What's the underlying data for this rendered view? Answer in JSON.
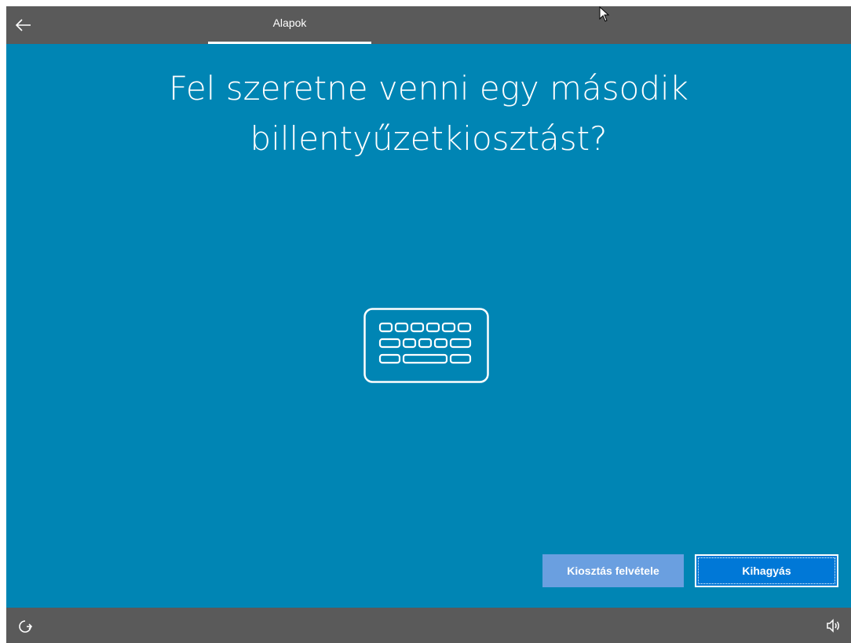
{
  "header": {
    "back_icon": "arrow-left-icon",
    "tab_label": "Alapok"
  },
  "main": {
    "title_line1": "Fel szeretne venni egy második",
    "title_line2": "billentyűzetkiosztást?",
    "illustration_icon": "keyboard-icon",
    "background_color": "#0085b4"
  },
  "buttons": {
    "add_layout_label": "Kiosztás felvétele",
    "skip_label": "Kihagyás"
  },
  "footer": {
    "left_icon": "ease-of-access-icon",
    "right_icon": "volume-icon"
  },
  "colors": {
    "bar": "#5a5a5a",
    "accent": "#0078d7",
    "secondary_button": "#6a9fe0"
  }
}
